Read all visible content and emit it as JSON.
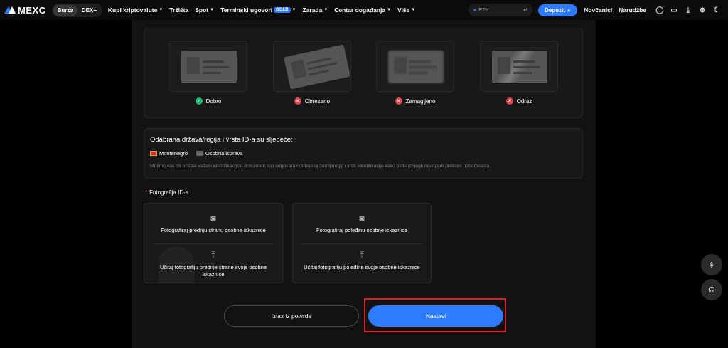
{
  "nav": {
    "logo": "MEXC",
    "pills": [
      "Burza",
      "DEX+"
    ],
    "items": [
      "Kupi kriptovalute",
      "Tržišta",
      "Spot",
      "Terminski ugovori",
      "Zarada",
      "Centar događanja",
      "Više"
    ],
    "gold_badge": "GOLD",
    "search_placeholder": "ETH",
    "deposit": "Depozit",
    "wallets": "Novčanici",
    "orders": "Narudžbe"
  },
  "samples": [
    {
      "label": "Dobro",
      "status": "ok"
    },
    {
      "label": "Obrezano",
      "status": "bad"
    },
    {
      "label": "Zamagljeno",
      "status": "bad"
    },
    {
      "label": "Odraz",
      "status": "bad"
    }
  ],
  "info": {
    "title": "Odabrana država/regija i vrsta ID-a su sljedeće:",
    "country": "Montenegro",
    "id_type": "Osobna isprava",
    "notice": "Molimo vas da učitate važeći identifikacijski dokument koji odgovara odabranoj zemlji/regiji i vrsti identifikacije kako biste izbjegli neuspjeh prilikom potvrđivanja."
  },
  "upload": {
    "section_label": "Fotografija ID-a",
    "front_photo": "Fotografiraj prednju stranu osobne iskaznice",
    "front_upload": "Učitaj fotografiju prednje strane svoje osobne iskaznice",
    "back_photo": "Fotografiraj poleđinu osobne iskaznice",
    "back_upload": "Učitaj fotografiju poleđine svoje osobne iskaznice"
  },
  "buttons": {
    "exit": "Izlaz iz potvrde",
    "next": "Nastavi"
  }
}
